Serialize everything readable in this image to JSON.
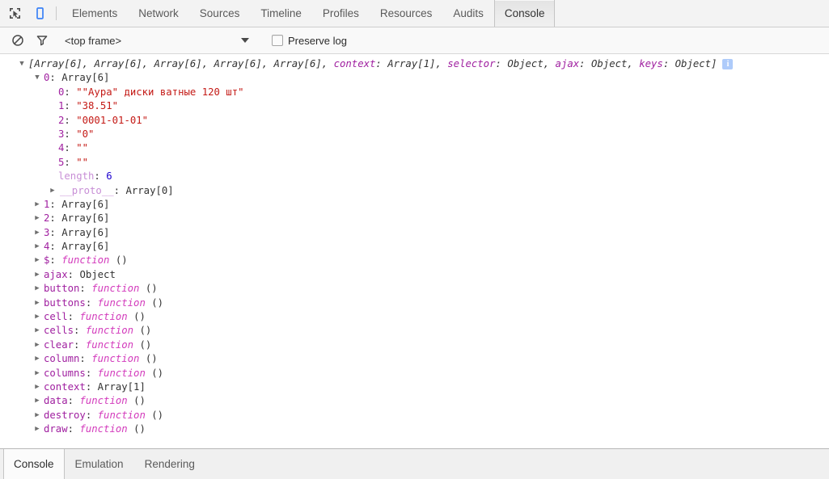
{
  "toolbar": {
    "inspect_icon": "inspect-element-icon",
    "device_icon": "device-toolbar-icon",
    "tabs": [
      {
        "label": "Elements",
        "active": false
      },
      {
        "label": "Network",
        "active": false
      },
      {
        "label": "Sources",
        "active": false
      },
      {
        "label": "Timeline",
        "active": false
      },
      {
        "label": "Profiles",
        "active": false
      },
      {
        "label": "Resources",
        "active": false
      },
      {
        "label": "Audits",
        "active": false
      },
      {
        "label": "Console",
        "active": true
      }
    ]
  },
  "console_toolbar": {
    "clear_icon": "clear-console-icon",
    "filter_icon": "filter-icon",
    "frame_value": "<top frame>",
    "caret_icon": "chevron-down-icon",
    "preserve_log_label": "Preserve log",
    "preserve_log_checked": false
  },
  "console_output": {
    "info_badge": "i",
    "header": {
      "prefix": "[",
      "items": "Array[6], Array[6], Array[6], Array[6], Array[6], ",
      "context_key": "context",
      "context_val": "Array[1]",
      "selector_key": "selector",
      "selector_val": "Object",
      "ajax_key": "ajax",
      "ajax_val": "Object",
      "keys_key": "keys",
      "keys_val": "Object",
      "suffix": "]"
    },
    "item0": {
      "key": "0",
      "value": "Array[6]",
      "entries": [
        {
          "key": "0",
          "value": "\"\"Аура\" диски ватные 120 шт\"",
          "type": "string"
        },
        {
          "key": "1",
          "value": "\"38.51\"",
          "type": "string"
        },
        {
          "key": "2",
          "value": "\"0001-01-01\"",
          "type": "string"
        },
        {
          "key": "3",
          "value": "\"0\"",
          "type": "string"
        },
        {
          "key": "4",
          "value": "\"\"",
          "type": "string"
        },
        {
          "key": "5",
          "value": "\"\"",
          "type": "string"
        }
      ],
      "length_key": "length",
      "length_value": "6",
      "proto_key": "__proto__",
      "proto_value": "Array[0]"
    },
    "properties": [
      {
        "key": "1",
        "value": "Array[6]",
        "type": "object",
        "keytype": "index"
      },
      {
        "key": "2",
        "value": "Array[6]",
        "type": "object",
        "keytype": "index"
      },
      {
        "key": "3",
        "value": "Array[6]",
        "type": "object",
        "keytype": "index"
      },
      {
        "key": "4",
        "value": "Array[6]",
        "type": "object",
        "keytype": "index"
      },
      {
        "key": "$",
        "value": "function ()",
        "type": "function",
        "keytype": "name"
      },
      {
        "key": "ajax",
        "value": "Object",
        "type": "object",
        "keytype": "name"
      },
      {
        "key": "button",
        "value": "function ()",
        "type": "function",
        "keytype": "name"
      },
      {
        "key": "buttons",
        "value": "function ()",
        "type": "function",
        "keytype": "name"
      },
      {
        "key": "cell",
        "value": "function ()",
        "type": "function",
        "keytype": "name"
      },
      {
        "key": "cells",
        "value": "function ()",
        "type": "function",
        "keytype": "name"
      },
      {
        "key": "clear",
        "value": "function ()",
        "type": "function",
        "keytype": "name"
      },
      {
        "key": "column",
        "value": "function ()",
        "type": "function",
        "keytype": "name"
      },
      {
        "key": "columns",
        "value": "function ()",
        "type": "function",
        "keytype": "name"
      },
      {
        "key": "context",
        "value": "Array[1]",
        "type": "object",
        "keytype": "name"
      },
      {
        "key": "data",
        "value": "function ()",
        "type": "function",
        "keytype": "name"
      },
      {
        "key": "destroy",
        "value": "function ()",
        "type": "function",
        "keytype": "name"
      },
      {
        "key": "draw",
        "value": "function ()",
        "type": "function",
        "keytype": "name"
      }
    ]
  },
  "drawer": {
    "tabs": [
      {
        "label": "Console",
        "active": true
      },
      {
        "label": "Emulation",
        "active": false
      },
      {
        "label": "Rendering",
        "active": false
      }
    ]
  }
}
